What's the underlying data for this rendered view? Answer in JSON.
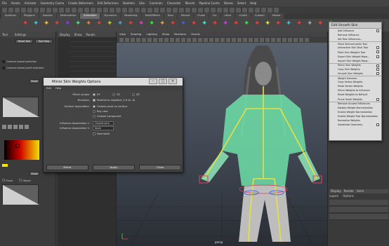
{
  "menubar": [
    "File",
    "Assets",
    "Animate",
    "Geometry Cache",
    "Create Deformers",
    "Edit Deformers",
    "Skeleton",
    "Skin",
    "Constrain",
    "Character",
    "Muscle",
    "Pipeline Cache",
    "Stereo",
    "Select",
    "Help"
  ],
  "shelf_tabs": [
    "Surfaces",
    "Polygons",
    "Subdivs",
    "Deformation",
    "Animation",
    "Dynamics",
    "Rendering",
    "PaintEffects",
    "Toon",
    "Muscle",
    "Fluids",
    "Fur",
    "nHair",
    "nCloth",
    "Custom",
    "Stereo"
  ],
  "shelf_active_tab": "Animation",
  "left_panel": {
    "tabs": [
      "Tool",
      "Settings"
    ],
    "reset_tool": "Reset Tool",
    "tool_help": "Tool Help",
    "rows": [
      "Camera based selection",
      "Camera based paint selection"
    ],
    "flood_button": "Flood",
    "radio_labels": [
      "Flood",
      "Object"
    ]
  },
  "outliner": {
    "tabs": [
      "Display",
      "Show",
      "Panels"
    ]
  },
  "viewport": {
    "menu": [
      "View",
      "Shading",
      "Lighting",
      "Show",
      "Renderer",
      "Panels"
    ],
    "label": "persp"
  },
  "right_panel": {
    "tabs": [
      "Layers",
      "Options"
    ],
    "tab_labels": [
      "Display",
      "Render",
      "Anim"
    ]
  },
  "mirror_dialog": {
    "title": "Mirror Skin Weights Options",
    "menu": [
      "Edit",
      "Help"
    ],
    "mirror_across_label": "Mirror across:",
    "mirror_across_options": [
      "XY",
      "YZ",
      "XZ"
    ],
    "mirror_across_selected": "XY",
    "direction_label": "Direction:",
    "direction_option": "Positive to negative (+X to -X)",
    "surface_assoc_label": "Surface Association:",
    "surface_assoc_options": [
      "Closest point on surface",
      "Ray cast",
      "Closest component"
    ],
    "surface_assoc_selected": "Closest point on surface",
    "influence_assoc1_label": "Influence Association 1:",
    "influence_assoc1_value": "Closest joint",
    "influence_assoc2_label": "Influence Association 2:",
    "influence_assoc2_value": "None",
    "normalize_label": "Normalize",
    "buttons": [
      "Mirror",
      "Apply",
      "Close"
    ]
  },
  "smooth_skin_menu": {
    "title": "Edit Smooth Skin",
    "items": [
      {
        "label": "Add Influence",
        "option": true
      },
      {
        "label": "Remove Influence",
        "option": false
      },
      {
        "label": "Set Max Influences...",
        "option": false
      },
      {
        "label": "Move Skinned Joints Tool",
        "option": false
      },
      {
        "label": "Interactive Skin Bind Tool",
        "option": true
      },
      {
        "label": "Paint Skin Weights Tool",
        "option": true
      },
      {
        "label": "Export Skin Weight Maps...",
        "option": true
      },
      {
        "label": "Import Skin Weight Maps...",
        "option": false
      },
      {
        "label": "Mirror Skin Weights",
        "option": true
      },
      {
        "label": "Copy Skin Weights",
        "option": true
      },
      {
        "label": "Smooth Skin Weights",
        "option": true
      },
      {
        "label": "Weight Hammer",
        "option": false
      },
      {
        "label": "Copy Vertex Weights",
        "option": false
      },
      {
        "label": "Paste Vertex Weights",
        "option": false
      },
      {
        "label": "Mirror Weights to Influence",
        "option": false
      },
      {
        "label": "Reset Weights to Default",
        "option": false
      },
      {
        "label": "Prune Small Weights",
        "option": true
      },
      {
        "label": "Remove Unused Influences",
        "option": false
      },
      {
        "label": "Disable Weight Normalization",
        "option": false
      },
      {
        "label": "Enable Weight Normalization",
        "option": false
      },
      {
        "label": "Enable Weight Post Normalization",
        "option": false
      },
      {
        "label": "Normalize Weights",
        "option": false
      },
      {
        "label": "Substitute Geometry",
        "option": true
      }
    ]
  },
  "colors": {
    "accent": "#d8d8d8",
    "skeleton": "#e8e040",
    "mesh": "#6fe0a8"
  }
}
